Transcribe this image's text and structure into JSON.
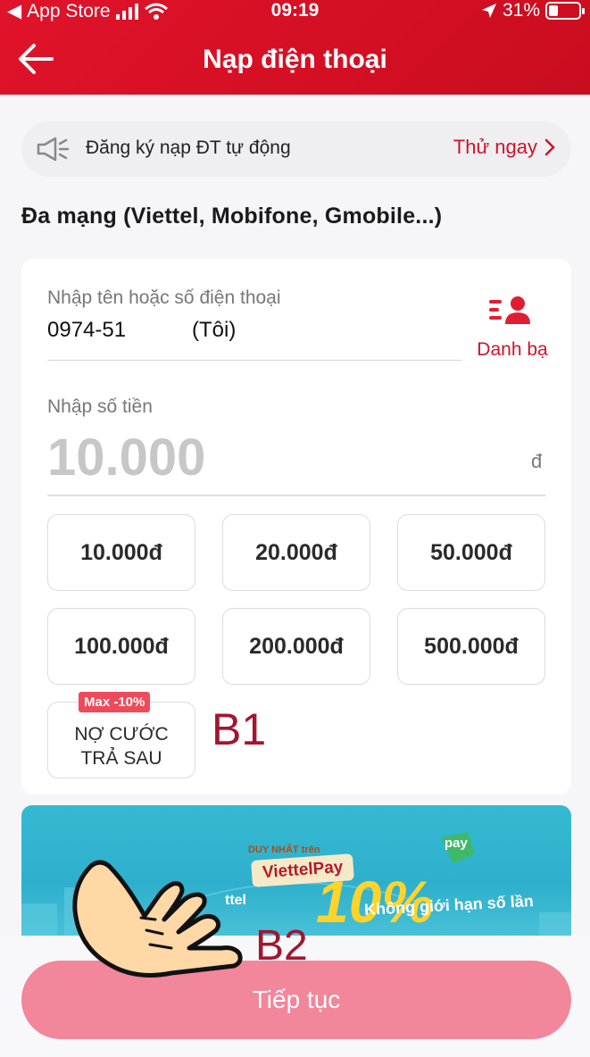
{
  "status_bar": {
    "carrier": "App Store",
    "time": "09:19",
    "battery": "31%"
  },
  "header": {
    "title": "Nạp điện thoại"
  },
  "promo": {
    "text": "Đăng ký nạp ĐT tự động",
    "cta": "Thử ngay"
  },
  "network_title": "Đa mạng (Viettel, Mobifone, Gmobile...)",
  "phone": {
    "label": "Nhập tên hoặc số điện thoại",
    "value": "0974-51",
    "owner": "(Tôi)"
  },
  "contacts": {
    "label": "Danh bạ"
  },
  "amount": {
    "label": "Nhập số tiền",
    "placeholder": "10.000",
    "currency": "đ"
  },
  "denominations": [
    "10.000đ",
    "20.000đ",
    "50.000đ",
    "100.000đ",
    "200.000đ",
    "500.000đ"
  ],
  "postpaid": {
    "line1": "NỢ CƯỚC",
    "line2": "TRẢ SAU",
    "badge": "Max -10%"
  },
  "annotations": {
    "b1": "B1",
    "b2": "B2"
  },
  "banner": {
    "tag1": "DUY NHẤT trên",
    "tag2": "ViettelPay",
    "big": "10%",
    "line": "Không giới hạn số lần",
    "side": "ttel",
    "pay": "pay"
  },
  "continue_button": "Tiếp tục"
}
